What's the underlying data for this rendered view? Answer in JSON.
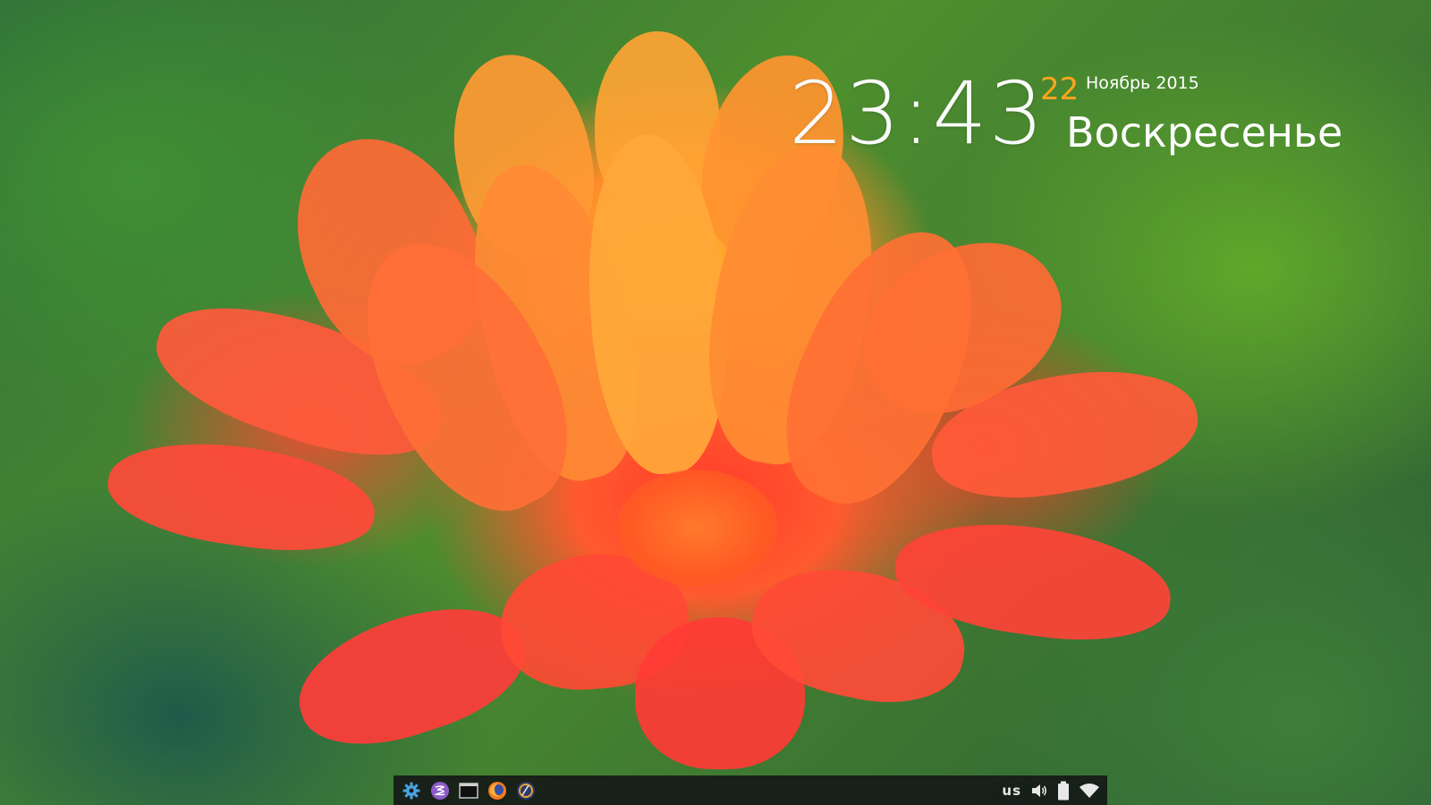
{
  "clock": {
    "time": "23:43",
    "day": "22",
    "month_year": "Ноябрь 2015",
    "weekday": "Воскресенье",
    "accent_color": "#ffa51c"
  },
  "taskbar": {
    "launchers": [
      {
        "icon": "settings-gear-icon"
      },
      {
        "icon": "emacs-icon"
      },
      {
        "icon": "terminal-icon"
      },
      {
        "icon": "firefox-icon"
      },
      {
        "icon": "browser-icon"
      }
    ],
    "tray": {
      "keyboard_layout": "us",
      "volume_icon": "speaker-icon",
      "battery_icon": "battery-icon",
      "network_icon": "wifi-icon"
    }
  }
}
